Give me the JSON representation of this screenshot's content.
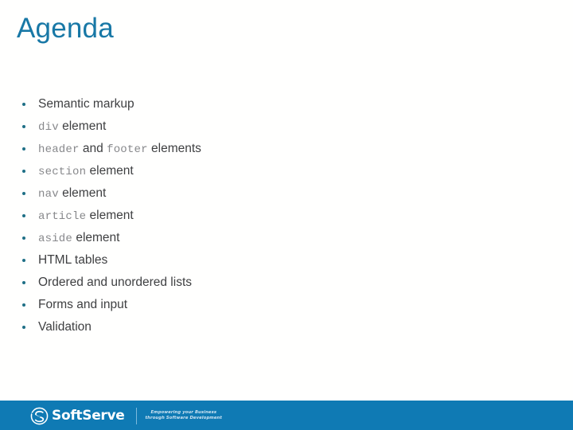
{
  "slide": {
    "title": "Agenda",
    "title_color": "#1878a6",
    "background_color": "#ffffff"
  },
  "agenda": {
    "items": [
      {
        "parts": [
          {
            "kind": "text",
            "value": "Semantic markup"
          }
        ]
      },
      {
        "parts": [
          {
            "kind": "code",
            "value": "div"
          },
          {
            "kind": "text",
            "value": " element"
          }
        ]
      },
      {
        "parts": [
          {
            "kind": "code",
            "value": "header"
          },
          {
            "kind": "text",
            "value": " and "
          },
          {
            "kind": "code",
            "value": "footer"
          },
          {
            "kind": "text",
            "value": " elements"
          }
        ]
      },
      {
        "parts": [
          {
            "kind": "code",
            "value": "section"
          },
          {
            "kind": "text",
            "value": " element"
          }
        ]
      },
      {
        "parts": [
          {
            "kind": "code",
            "value": "nav"
          },
          {
            "kind": "text",
            "value": " element"
          }
        ]
      },
      {
        "parts": [
          {
            "kind": "code",
            "value": "article"
          },
          {
            "kind": "text",
            "value": " element"
          }
        ]
      },
      {
        "parts": [
          {
            "kind": "code",
            "value": "aside"
          },
          {
            "kind": "text",
            "value": " element"
          }
        ]
      },
      {
        "parts": [
          {
            "kind": "text",
            "value": "HTML tables"
          }
        ]
      },
      {
        "parts": [
          {
            "kind": "text",
            "value": "Ordered and unordered lists"
          }
        ]
      },
      {
        "parts": [
          {
            "kind": "text",
            "value": "Forms and input"
          }
        ]
      },
      {
        "parts": [
          {
            "kind": "text",
            "value": "Validation"
          }
        ]
      }
    ],
    "bullet_color": "#1f6f86",
    "text_color": "#3f4042",
    "code_color": "#87888b"
  },
  "footer": {
    "background_color": "#0f7ab4",
    "logo_icon": "softserve-s-logo-icon",
    "logo_text": "SoftServe",
    "tagline_line1": "Empowering your Business",
    "tagline_line2": "through Software Development"
  }
}
